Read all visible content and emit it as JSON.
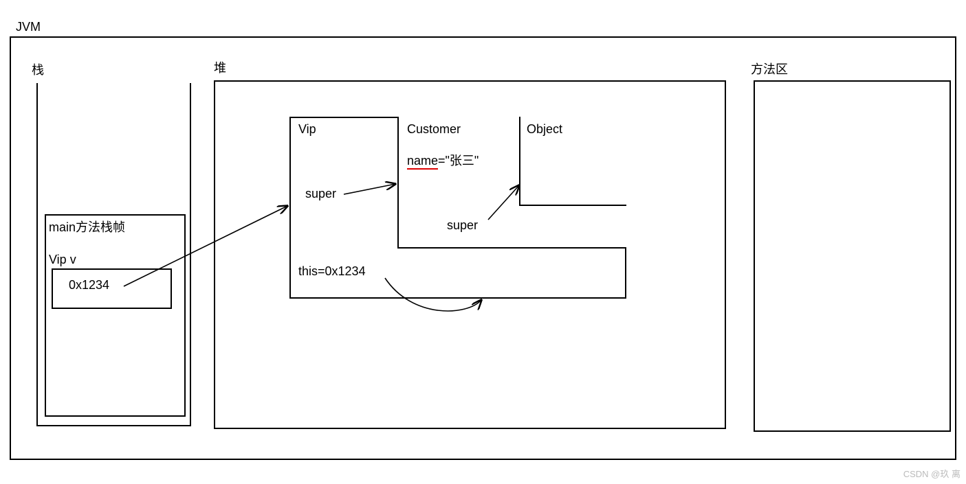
{
  "jvm": {
    "title": "JVM"
  },
  "stack": {
    "title": "栈",
    "frame_title": "main方法栈帧",
    "var_label": "Vip v",
    "var_value": "0x1234"
  },
  "heap": {
    "title": "堆",
    "vip": {
      "title": "Vip",
      "super_label": "super",
      "this_label": "this=0x1234"
    },
    "customer": {
      "title": "Customer",
      "name_label": "name",
      "name_value": "=\"张三\"",
      "super_label": "super"
    },
    "object": {
      "title": "Object"
    }
  },
  "method_area": {
    "title": "方法区"
  },
  "watermark": "CSDN @玖 离"
}
